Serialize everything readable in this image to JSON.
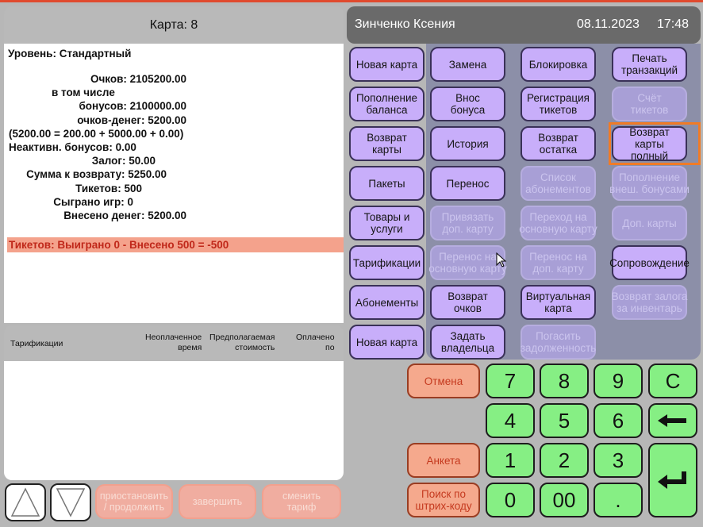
{
  "card_title": "Карта: 8",
  "header": {
    "user": "Зинченко Ксения",
    "date": "08.11.2023",
    "time": "17:48"
  },
  "card": {
    "level": "Уровень: Стандартный",
    "points": "Очков: 2105200.00",
    "including": "в том числе",
    "bonuses": "бонусов: 2100000.00",
    "money_points": "очков-денег: 5200.00",
    "formula": "(5200.00 = 200.00 + 5000.00 + 0.00)",
    "inactive_bonuses": "Неактивн. бонусов: 0.00",
    "deposit": "Залог: 50.00",
    "refund": "Сумма к возврату: 5250.00",
    "tickets": "Тикетов: 500",
    "games": "Сыграно игр: 0",
    "money_in": "Внесено денег: 5200.00",
    "tickets_summary": "Тикетов: Выиграно 0 - Внесено 500 = -500"
  },
  "tariffs": {
    "col_name": "Тарификации",
    "col_unpaid_1": "Неоплаченное",
    "col_unpaid_2": "время",
    "col_cost_1": "Предполагаемая",
    "col_cost_2": "стоимость",
    "col_paid_1": "Оплачено",
    "col_paid_2": "по"
  },
  "bottom": {
    "suspend_1": "приостановить",
    "suspend_2": "/ продолжить",
    "finish": "завершить",
    "change_1": "сменить",
    "change_2": "тариф"
  },
  "left_buttons": {
    "new_card": "Новая карта",
    "topup_1": "Пополнение",
    "topup_2": "баланса",
    "return_card_1": "Возврат",
    "return_card_2": "карты",
    "packages": "Пакеты",
    "goods_1": "Товары и",
    "goods_2": "услуги",
    "tariffs": "Тарификации",
    "subscriptions": "Абонементы",
    "new_card2": "Новая карта"
  },
  "grid_buttons": {
    "replace": "Замена",
    "block": "Блокировка",
    "print_1": "Печать",
    "print_2": "транзакций",
    "bonus_in_1": "Внос",
    "bonus_in_2": "бонуса",
    "reg_tickets_1": "Регистрация",
    "reg_tickets_2": "тикетов",
    "ticket_account_1": "Счёт",
    "ticket_account_2": "тикетов",
    "history": "История",
    "return_rest_1": "Возврат",
    "return_rest_2": "остатка",
    "return_full_1": "Возврат карты",
    "return_full_2": "полный",
    "transfer": "Перенос",
    "subs_list_1": "Список",
    "subs_list_2": "абонементов",
    "ext_bonus_1": "Пополнение",
    "ext_bonus_2": "внеш. бонусами",
    "bind_extra_1": "Привязать",
    "bind_extra_2": "доп. карту",
    "goto_main_1": "Переход на",
    "goto_main_2": "основную карту",
    "extra_cards": "Доп. карты",
    "move_to_main_1": "Перенос на",
    "move_to_main_2": "основную карту",
    "move_to_extra_1": "Перенос на",
    "move_to_extra_2": "доп. карту",
    "escort": "Сопровождение",
    "return_points_1": "Возврат",
    "return_points_2": "очков",
    "virtual_1": "Виртуальная",
    "virtual_2": "карта",
    "return_deposit_1": "Возврат залога",
    "return_deposit_2": "за инвентарь",
    "set_owner_1": "Задать",
    "set_owner_2": "владельца",
    "pay_debt_1": "Погасить",
    "pay_debt_2": "задолженность"
  },
  "keypad": {
    "cancel": "Отмена",
    "survey": "Анкета",
    "barcode_1": "Поиск по",
    "barcode_2": "штрих-коду",
    "k7": "7",
    "k8": "8",
    "k9": "9",
    "kc": "C",
    "k4": "4",
    "k5": "5",
    "k6": "6",
    "k1": "1",
    "k2": "2",
    "k3": "3",
    "k0": "0",
    "k00": "00",
    "kdot": "."
  }
}
